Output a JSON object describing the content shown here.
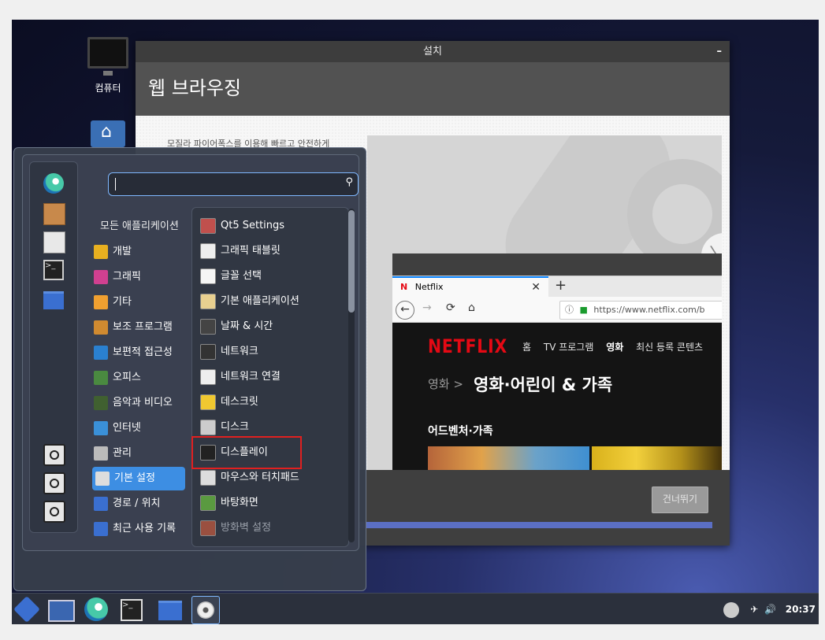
{
  "desktop": {
    "computer_label": "컴퓨터"
  },
  "install_window": {
    "title": "설치",
    "minimize": "–",
    "header": "웹 브라우징",
    "description": "모질라 파이어폭스를 이용해 빠르고 안전하게",
    "skip_button": "건너뛰기",
    "next_arrow": "〉",
    "progress": 1.0
  },
  "browser": {
    "tab_logo": "N",
    "tab_title": "Netflix",
    "tab_close": "✕",
    "new_tab": "+",
    "back": "←",
    "forward": "→",
    "reload": "⟳",
    "home": "⌂",
    "url_prefix": "ⓘ",
    "url": "https://www.netflix.com/b",
    "netflix": {
      "logo": "NETFLIX",
      "menu": [
        "홈",
        "TV 프로그램",
        "영화",
        "최신 등록 콘텐츠"
      ],
      "crumb": "영화 >",
      "crumb_title": "영화·어린이 & 가족",
      "row_title": "어드벤처·가족"
    }
  },
  "start_menu": {
    "search_icon": "search-icon",
    "all_apps_label": "모든 애플리케이션",
    "categories": [
      {
        "label": "개발",
        "color": "#e8b020"
      },
      {
        "label": "그래픽",
        "color": "#d04090"
      },
      {
        "label": "기타",
        "color": "#f0a030"
      },
      {
        "label": "보조 프로그램",
        "color": "#d08a30"
      },
      {
        "label": "보편적 접근성",
        "color": "#2a80d0"
      },
      {
        "label": "오피스",
        "color": "#4a8a40"
      },
      {
        "label": "음악과 비디오",
        "color": "#406030"
      },
      {
        "label": "인터넷",
        "color": "#3a90d8"
      },
      {
        "label": "관리",
        "color": "#bbbbbb"
      },
      {
        "label": "기본 설정",
        "color": "#dddddd"
      },
      {
        "label": "경로 / 위치",
        "color": "#3a6fd0"
      },
      {
        "label": "최근 사용 기록",
        "color": "#3a6fd0"
      }
    ],
    "selected_category": "기본 설정",
    "apps": [
      {
        "label": "Qt5 Settings",
        "color": "#c0504d"
      },
      {
        "label": "그래픽 태블릿",
        "color": "#eeeeee"
      },
      {
        "label": "글꼴 선택",
        "color": "#f5f5f5"
      },
      {
        "label": "기본 애플리케이션",
        "color": "#e8d090"
      },
      {
        "label": "날짜 & 시간",
        "color": "#444444"
      },
      {
        "label": "네트워크",
        "color": "#333333"
      },
      {
        "label": "네트워크 연결",
        "color": "#eeeeee"
      },
      {
        "label": "데스크릿",
        "color": "#f0c830"
      },
      {
        "label": "디스크",
        "color": "#cccccc"
      },
      {
        "label": "디스플레이",
        "color": "#222222"
      },
      {
        "label": "마우스와 터치패드",
        "color": "#dddddd"
      },
      {
        "label": "바탕화면",
        "color": "#5a9a40"
      },
      {
        "label": "방화벽 설정",
        "color": "#9a5040"
      }
    ],
    "highlighted_app": "디스플레이"
  },
  "taskbar": {
    "terminal_glyph": ">_",
    "wifi": "✈",
    "volume": "🔊",
    "clock": "20:37"
  }
}
